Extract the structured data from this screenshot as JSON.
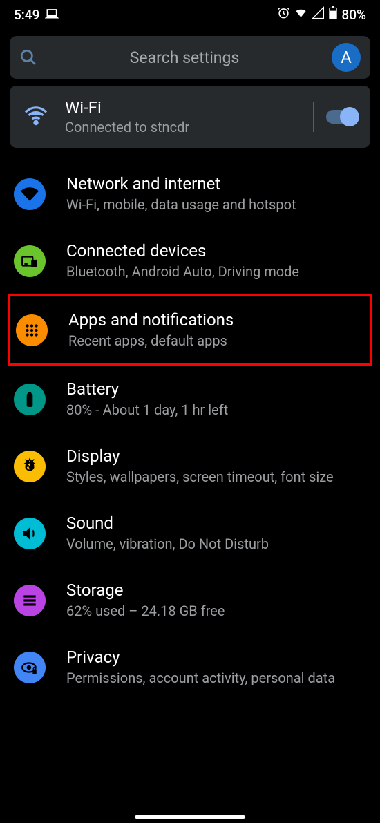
{
  "status": {
    "time": "5:49",
    "battery": "80%"
  },
  "search": {
    "placeholder": "Search settings",
    "avatar_letter": "A"
  },
  "wifi_card": {
    "title": "Wi-Fi",
    "subtitle": "Connected to stncdr"
  },
  "items": [
    {
      "title": "Network and internet",
      "subtitle": "Wi-Fi, mobile, data usage and hotspot"
    },
    {
      "title": "Connected devices",
      "subtitle": "Bluetooth, Android Auto, Driving mode"
    },
    {
      "title": "Apps and notifications",
      "subtitle": "Recent apps, default apps"
    },
    {
      "title": "Battery",
      "subtitle": "80% - About 1 day, 1 hr left"
    },
    {
      "title": "Display",
      "subtitle": "Styles, wallpapers, screen timeout, font size"
    },
    {
      "title": "Sound",
      "subtitle": "Volume, vibration, Do Not Disturb"
    },
    {
      "title": "Storage",
      "subtitle": "62% used – 24.18 GB free"
    },
    {
      "title": "Privacy",
      "subtitle": "Permissions, account activity, personal data"
    }
  ]
}
